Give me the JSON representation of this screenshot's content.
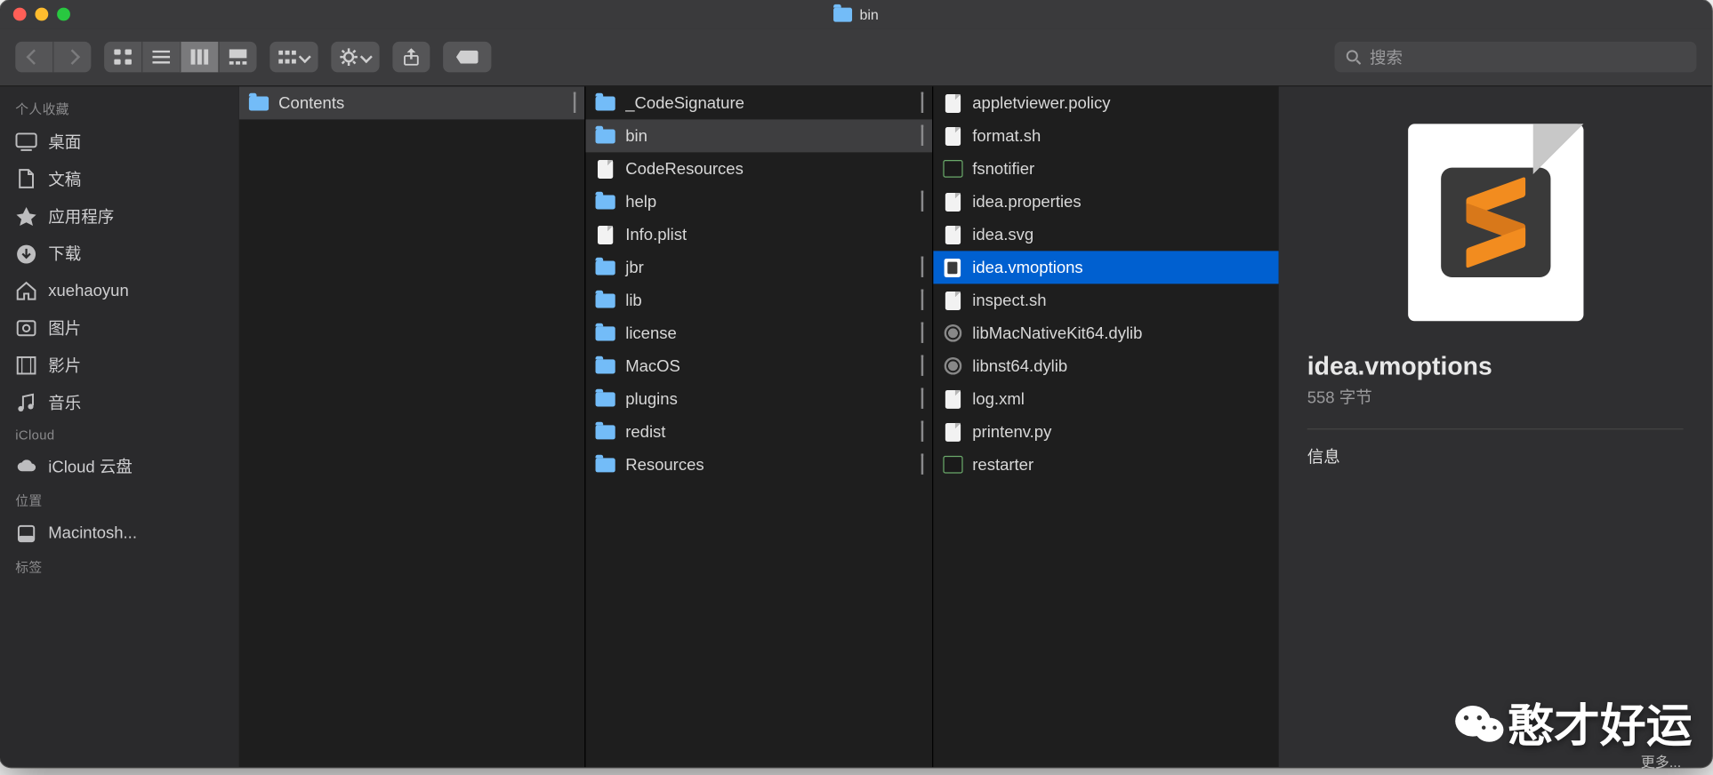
{
  "window": {
    "title": "bin"
  },
  "search": {
    "placeholder": "搜索"
  },
  "sidebar": {
    "sections": [
      {
        "header": "个人收藏",
        "items": [
          {
            "label": "桌面",
            "icon": "desktop-icon"
          },
          {
            "label": "文稿",
            "icon": "documents-icon"
          },
          {
            "label": "应用程序",
            "icon": "applications-icon"
          },
          {
            "label": "下载",
            "icon": "downloads-icon"
          },
          {
            "label": "xuehaoyun",
            "icon": "home-icon"
          },
          {
            "label": "图片",
            "icon": "pictures-icon"
          },
          {
            "label": "影片",
            "icon": "movies-icon"
          },
          {
            "label": "音乐",
            "icon": "music-icon"
          }
        ]
      },
      {
        "header": "iCloud",
        "items": [
          {
            "label": "iCloud 云盘",
            "icon": "cloud-icon"
          }
        ]
      },
      {
        "header": "位置",
        "items": [
          {
            "label": "Macintosh...",
            "icon": "disk-icon"
          }
        ]
      },
      {
        "header": "标签",
        "items": []
      }
    ]
  },
  "columns": [
    {
      "items": [
        {
          "label": "Contents",
          "type": "folder",
          "hasChildren": true,
          "selected": "dark"
        }
      ]
    },
    {
      "items": [
        {
          "label": "_CodeSignature",
          "type": "folder",
          "hasChildren": true
        },
        {
          "label": "bin",
          "type": "folder",
          "hasChildren": true,
          "selected": "dark"
        },
        {
          "label": "CodeResources",
          "type": "file"
        },
        {
          "label": "help",
          "type": "folder",
          "hasChildren": true
        },
        {
          "label": "Info.plist",
          "type": "file"
        },
        {
          "label": "jbr",
          "type": "folder",
          "hasChildren": true
        },
        {
          "label": "lib",
          "type": "folder",
          "hasChildren": true
        },
        {
          "label": "license",
          "type": "folder",
          "hasChildren": true
        },
        {
          "label": "MacOS",
          "type": "folder",
          "hasChildren": true
        },
        {
          "label": "plugins",
          "type": "folder",
          "hasChildren": true
        },
        {
          "label": "redist",
          "type": "folder",
          "hasChildren": true
        },
        {
          "label": "Resources",
          "type": "folder",
          "hasChildren": true
        }
      ]
    },
    {
      "items": [
        {
          "label": "appletviewer.policy",
          "type": "file"
        },
        {
          "label": "format.sh",
          "type": "file"
        },
        {
          "label": "fsnotifier",
          "type": "exec"
        },
        {
          "label": "idea.properties",
          "type": "file"
        },
        {
          "label": "idea.svg",
          "type": "file"
        },
        {
          "label": "idea.vmoptions",
          "type": "sublime",
          "selected": "blue"
        },
        {
          "label": "inspect.sh",
          "type": "file"
        },
        {
          "label": "libMacNativeKit64.dylib",
          "type": "gear"
        },
        {
          "label": "libnst64.dylib",
          "type": "gear"
        },
        {
          "label": "log.xml",
          "type": "file"
        },
        {
          "label": "printenv.py",
          "type": "file"
        },
        {
          "label": "restarter",
          "type": "exec"
        }
      ]
    }
  ],
  "preview": {
    "name": "idea.vmoptions",
    "size": "558 字节",
    "section": "信息",
    "more": "更多..."
  },
  "watermark": {
    "text": "憨才好运"
  }
}
